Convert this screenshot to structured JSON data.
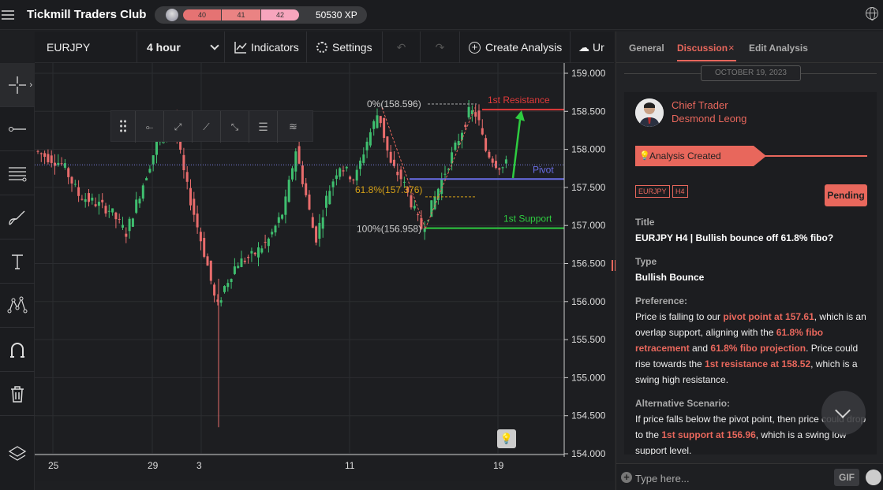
{
  "app": {
    "title": "Tickmill Traders Club",
    "levels": [
      "40",
      "41",
      "42"
    ],
    "xp": "50530 XP"
  },
  "toolbar": {
    "symbol": "EURJPY",
    "timeframe": "4 hour",
    "indicators": "Indicators",
    "settings": "Settings",
    "create": "Create Analysis",
    "upload": "Ur"
  },
  "chart": {
    "y_ticks": [
      "159.000",
      "158.500",
      "158.000",
      "157.500",
      "157.000",
      "156.500",
      "156.000",
      "155.500",
      "155.000",
      "154.500",
      "154.000"
    ],
    "x_ticks": [
      "25",
      "29",
      "3",
      "11",
      "19"
    ],
    "price_labels": {
      "resistance": "158.522",
      "current": "157.797",
      "pivot": "157.61",
      "support": "156.965"
    },
    "annotations": {
      "resistance": "1st Resistance",
      "pivot": "Pivot",
      "support": "1st Support",
      "fib0": "0%(158.596)",
      "fib618": "61.8%(157.376)",
      "fib100": "100%(156.958)"
    }
  },
  "chart_data": {
    "type": "candlestick",
    "x_tick_labels": [
      "25",
      "29",
      "3",
      "11",
      "19"
    ],
    "ylim": [
      154.0,
      159.0
    ],
    "levels": {
      "first_resistance": 158.522,
      "pivot": 157.61,
      "first_support": 156.965,
      "last_price": 157.797
    },
    "fibonacci": {
      "0%": 158.596,
      "61.8%": 157.376,
      "100%": 156.958
    }
  },
  "panel": {
    "tabs": [
      "General",
      "Discussion",
      "Edit Analysis"
    ],
    "date": "OCTOBER 19, 2023",
    "author_role": "Chief Trader",
    "author_name": "Desmond Leong",
    "banner": "Analysis Created",
    "tags": [
      "EURJPY",
      "H4"
    ],
    "status": "Pending",
    "title_label": "Title",
    "title": "EURJPY H4 | Bullish bounce off 61.8% fibo?",
    "type_label": "Type",
    "type": "Bullish Bounce",
    "preference_label": "Preference:",
    "preference": [
      "Price is falling to our ",
      "pivot point at 157.61",
      ", which is an overlap support, aligning with the ",
      "61.8% fibo retracement",
      " and ",
      "61.8% fibo projection",
      ". Price could rise towards the ",
      "1st resistance at 158.52",
      ", which is a swing high resistance."
    ],
    "alt_label": "Alternative Scenario:",
    "alternative": [
      "If price falls below the pivot point, then price could drop to the ",
      "1st support at 156.96",
      ", which is a swing low support level."
    ],
    "input_placeholder": "Type here...",
    "gif": "GIF"
  }
}
